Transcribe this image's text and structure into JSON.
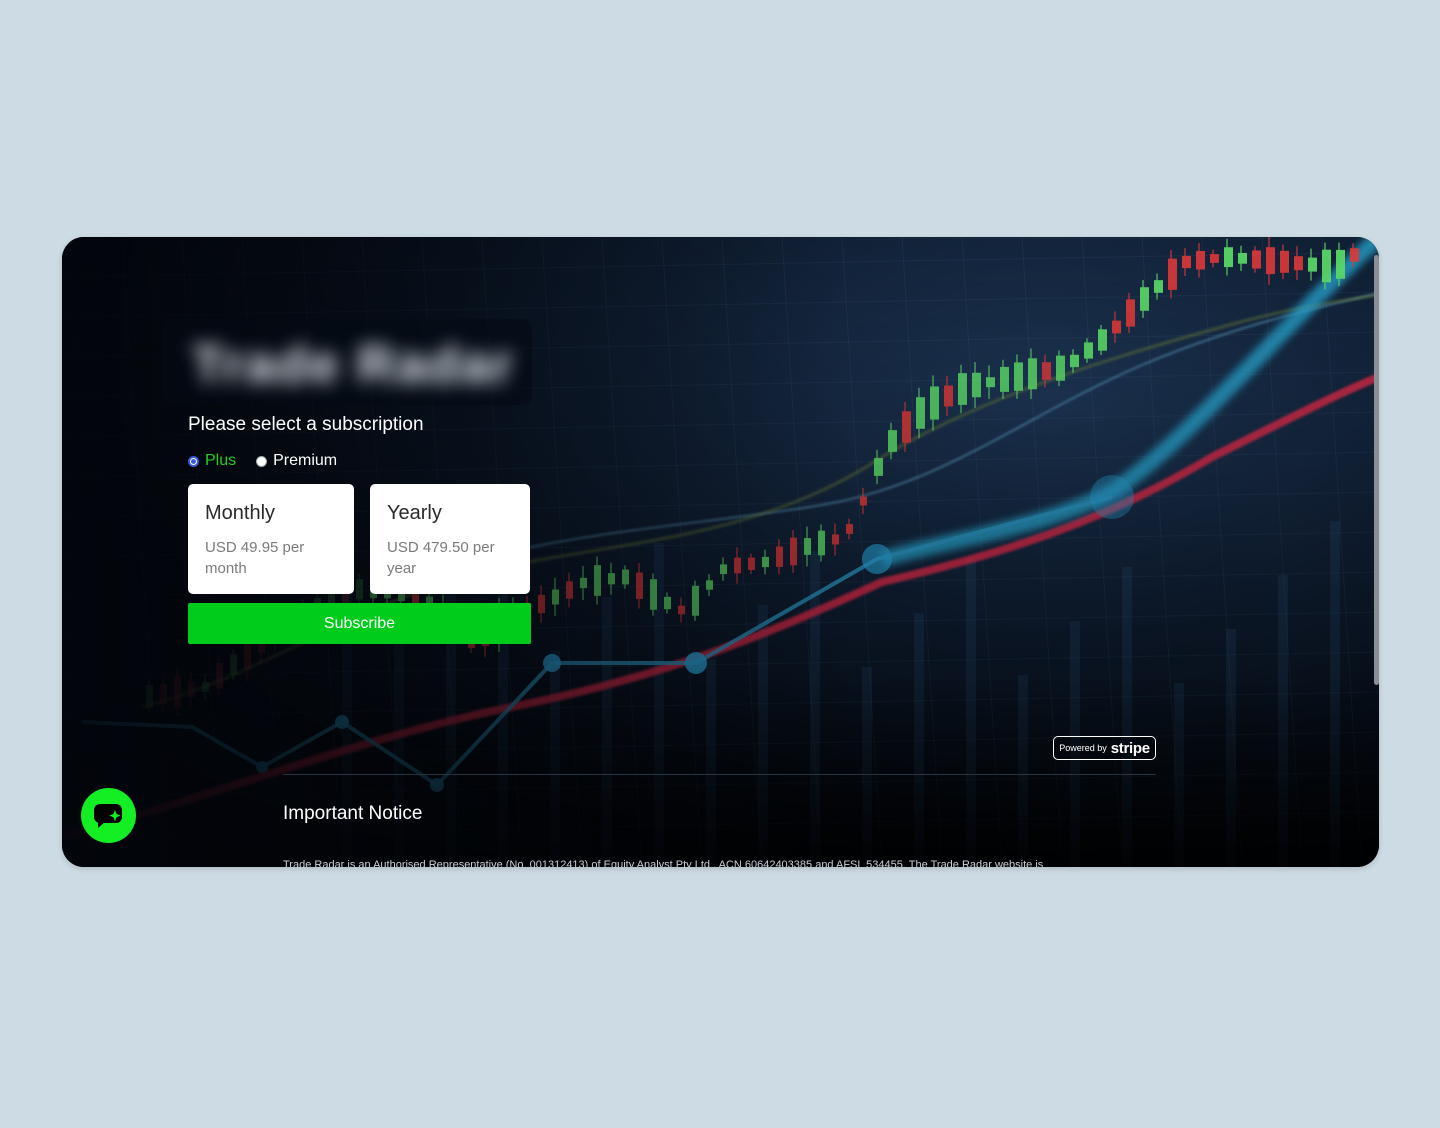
{
  "brand": {
    "logo_text": "Trade Radar"
  },
  "subscription": {
    "title": "Please select a subscription",
    "plans": [
      {
        "label": "Plus",
        "selected": true
      },
      {
        "label": "Premium",
        "selected": false
      }
    ],
    "options": [
      {
        "title": "Monthly",
        "price": "USD 49.95 per month"
      },
      {
        "title": "Yearly",
        "price": "USD 479.50 per year"
      }
    ],
    "subscribe_label": "Subscribe"
  },
  "stripe": {
    "powered_by": "Powered by",
    "brand": "stripe"
  },
  "notice": {
    "title": "Important Notice",
    "text": "Trade Radar is an Authorised Representative (No. 001312413) of Equity Analyst Pty Ltd , ACN 60642403385 and AFSL 534455. The Trade Radar website is"
  },
  "chat": {
    "icon": "chat-sparkle-icon"
  },
  "colors": {
    "accent_green": "#00cc1b",
    "chat_green": "#13ef23",
    "selected_plan_text": "#25d026",
    "radio_checked": "#3a5bd9",
    "background": "#cddbe4"
  }
}
